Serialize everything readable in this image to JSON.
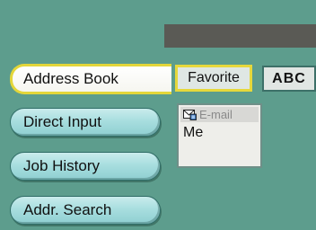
{
  "nav": {
    "items": [
      {
        "label": "Address Book",
        "active": true
      },
      {
        "label": "Direct Input",
        "active": false
      },
      {
        "label": "Job History",
        "active": false
      },
      {
        "label": "Addr. Search",
        "active": false
      }
    ]
  },
  "tabs": {
    "favorite": "Favorite",
    "abc": "ABC"
  },
  "list": {
    "entries": [
      {
        "type_label": "E-mail",
        "icon": "email-icon",
        "name": "Me"
      }
    ]
  },
  "colors": {
    "background": "#5d9d8d",
    "top_bar": "#5a5a55",
    "highlight": "#e6d83c"
  }
}
